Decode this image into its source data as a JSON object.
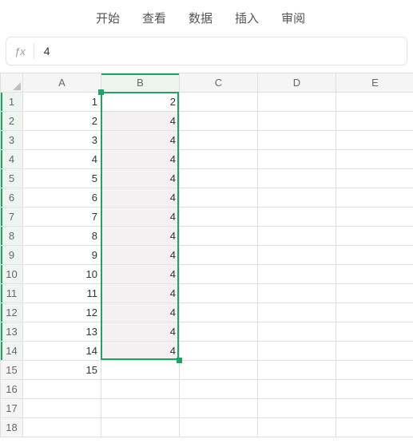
{
  "menu": {
    "items": [
      "开始",
      "查看",
      "数据",
      "插入",
      "审阅"
    ]
  },
  "formula_bar": {
    "fx_label": "ƒx",
    "value": "4"
  },
  "grid": {
    "columns": [
      "A",
      "B",
      "C",
      "D",
      "E"
    ],
    "row_count": 18,
    "cells": {
      "A": [
        1,
        2,
        3,
        4,
        5,
        6,
        7,
        8,
        9,
        10,
        11,
        12,
        13,
        14,
        15,
        "",
        "",
        ""
      ],
      "B": [
        2,
        4,
        4,
        4,
        4,
        4,
        4,
        4,
        4,
        4,
        4,
        4,
        4,
        4,
        "",
        "",
        "",
        ""
      ],
      "C": [
        "",
        "",
        "",
        "",
        "",
        "",
        "",
        "",
        "",
        "",
        "",
        "",
        "",
        "",
        "",
        "",
        "",
        ""
      ],
      "D": [
        "",
        "",
        "",
        "",
        "",
        "",
        "",
        "",
        "",
        "",
        "",
        "",
        "",
        "",
        "",
        "",
        "",
        ""
      ],
      "E": [
        "",
        "",
        "",
        "",
        "",
        "",
        "",
        "",
        "",
        "",
        "",
        "",
        "",
        "",
        "",
        "",
        "",
        ""
      ]
    },
    "selection": {
      "col": "B",
      "row_start": 1,
      "row_end": 14
    },
    "fill_preview": {
      "col": "B",
      "row_start": 2,
      "row_end": 14
    }
  },
  "chart_data": {
    "type": "table",
    "columns": [
      "A",
      "B"
    ],
    "rows": [
      {
        "A": 1,
        "B": 2
      },
      {
        "A": 2,
        "B": 4
      },
      {
        "A": 3,
        "B": 4
      },
      {
        "A": 4,
        "B": 4
      },
      {
        "A": 5,
        "B": 4
      },
      {
        "A": 6,
        "B": 4
      },
      {
        "A": 7,
        "B": 4
      },
      {
        "A": 8,
        "B": 4
      },
      {
        "A": 9,
        "B": 4
      },
      {
        "A": 10,
        "B": 4
      },
      {
        "A": 11,
        "B": 4
      },
      {
        "A": 12,
        "B": 4
      },
      {
        "A": 13,
        "B": 4
      },
      {
        "A": 14,
        "B": 4
      },
      {
        "A": 15,
        "B": null
      }
    ]
  }
}
